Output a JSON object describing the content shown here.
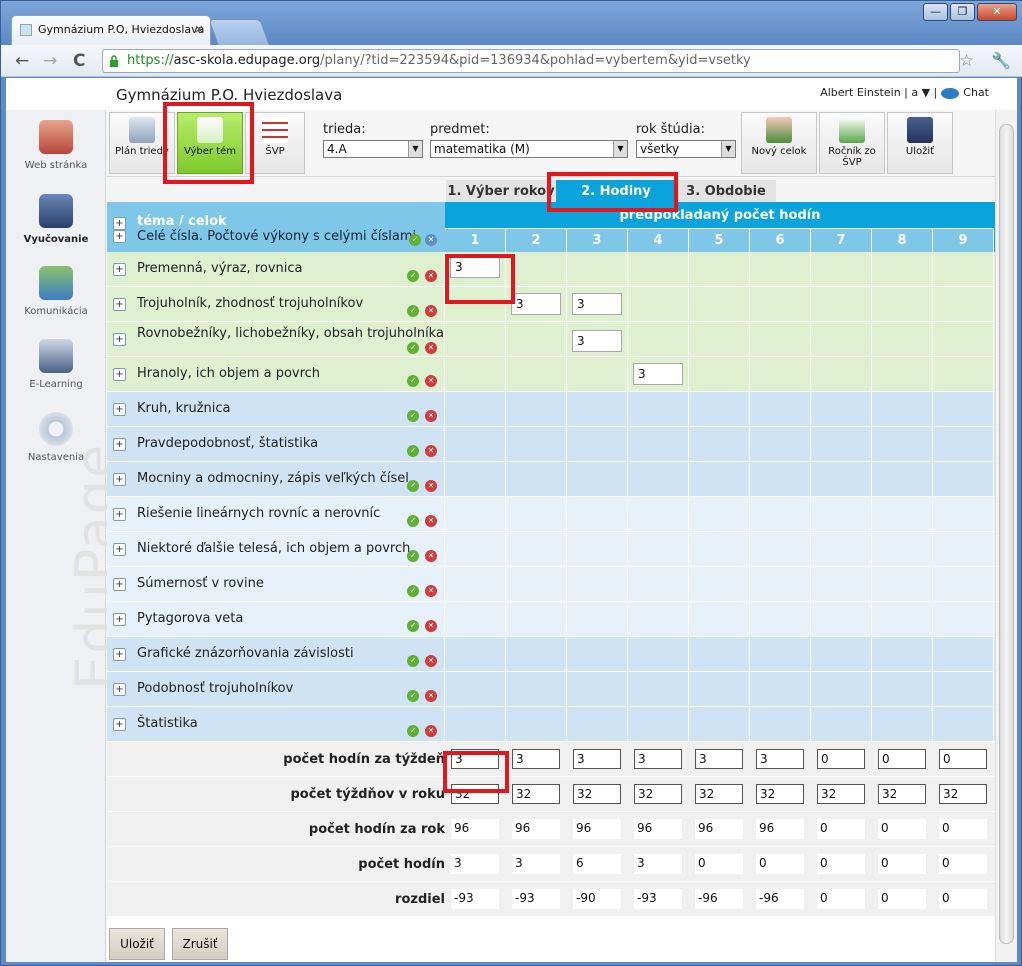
{
  "browser": {
    "tab_title": "Gymnázium P.O, Hviezdoslava",
    "tab_close": "×",
    "url_scheme": "https://",
    "url_host": "asc-skola.edupage.org",
    "url_path": "/plany/?tid=223594&pid=136934&pohlad=vybertem&yid=vsetky",
    "back": "←",
    "forward": "→",
    "reload": "C",
    "star": "☆",
    "wrench": "🔧",
    "minimize": "—",
    "maximize": "❐",
    "close": "✕"
  },
  "header": {
    "school": "Gymnázium P.O. Hviezdoslava",
    "user": "Albert Einstein | a ▼ |",
    "chat": "Chat"
  },
  "sidebar": {
    "items": [
      {
        "label": "Web stránka",
        "icon": "house-icon"
      },
      {
        "label": "Vyučovanie",
        "icon": "teaching-icon"
      },
      {
        "label": "Komunikácia",
        "icon": "people-icon"
      },
      {
        "label": "E-Learning",
        "icon": "monitor-icon"
      },
      {
        "label": "Nastavenia",
        "icon": "gear-icon"
      }
    ],
    "watermark": "EduPage"
  },
  "toolbar": {
    "plan_label": "Plán triedy",
    "select_topics_label": "Výber tém",
    "svp_label": "ŠVP",
    "trieda_label": "trieda:",
    "trieda_value": "4.A",
    "predmet_label": "predmet:",
    "predmet_value": "matematika (M)",
    "rok_label": "rok štúdia:",
    "rok_value": "všetky",
    "new_unit_label": "Nový celok",
    "year_from_svp_label": "Ročník zo ŠVP",
    "save_label": "Uložiť"
  },
  "tabs": [
    "1. Výber rokov",
    "2. Hodiny",
    "3. Obdobie"
  ],
  "grid": {
    "topic_header": "téma / celok",
    "group_label": "Celé čísla. Počtové výkony s celými číslami",
    "hours_header": "predpokladaný počet hodín",
    "columns": [
      "1",
      "2",
      "3",
      "4",
      "5",
      "6",
      "7",
      "8",
      "9"
    ],
    "topics": [
      {
        "label": "Premenná, výraz, rovnica",
        "values": [
          "3",
          "",
          "",
          "",
          "",
          "",
          "",
          "",
          ""
        ]
      },
      {
        "label": "Trojuholník, zhodnosť trojuholníkov",
        "values": [
          "",
          "3",
          "3",
          "",
          "",
          "",
          "",
          "",
          ""
        ]
      },
      {
        "label": "Rovnobežníky, lichobežníky, obsah trojuholníka",
        "values": [
          "",
          "",
          "3",
          "",
          "",
          "",
          "",
          "",
          ""
        ]
      },
      {
        "label": "Hranoly, ich objem a povrch",
        "values": [
          "",
          "",
          "",
          "3",
          "",
          "",
          "",
          "",
          ""
        ]
      },
      {
        "label": "Kruh, kružnica",
        "values": [
          "",
          "",
          "",
          "",
          "",
          "",
          "",
          "",
          ""
        ]
      },
      {
        "label": "Pravdepodobnosť, štatistika",
        "values": [
          "",
          "",
          "",
          "",
          "",
          "",
          "",
          "",
          ""
        ]
      },
      {
        "label": "Mocniny a odmocniny, zápis veľkých čísel",
        "values": [
          "",
          "",
          "",
          "",
          "",
          "",
          "",
          "",
          ""
        ]
      },
      {
        "label": "Riešenie lineárnych rovníc a nerovníc",
        "values": [
          "",
          "",
          "",
          "",
          "",
          "",
          "",
          "",
          ""
        ]
      },
      {
        "label": "Niektoré ďalšie telesá, ich objem a povrch",
        "values": [
          "",
          "",
          "",
          "",
          "",
          "",
          "",
          "",
          ""
        ]
      },
      {
        "label": "Súmernosť v rovine",
        "values": [
          "",
          "",
          "",
          "",
          "",
          "",
          "",
          "",
          ""
        ]
      },
      {
        "label": "Pytagorova veta",
        "values": [
          "",
          "",
          "",
          "",
          "",
          "",
          "",
          "",
          ""
        ]
      },
      {
        "label": "Grafické znázorňovania závislosti",
        "values": [
          "",
          "",
          "",
          "",
          "",
          "",
          "",
          "",
          ""
        ]
      },
      {
        "label": "Podobnosť trojuholníkov",
        "values": [
          "",
          "",
          "",
          "",
          "",
          "",
          "",
          "",
          ""
        ]
      },
      {
        "label": "Štatistika",
        "values": [
          "",
          "",
          "",
          "",
          "",
          "",
          "",
          "",
          ""
        ]
      }
    ],
    "summary": [
      {
        "label": "počet hodín za týždeň",
        "values": [
          "3",
          "3",
          "3",
          "3",
          "3",
          "3",
          "0",
          "0",
          "0"
        ],
        "editable": true
      },
      {
        "label": "počet týždňov v roku",
        "values": [
          "32",
          "32",
          "32",
          "32",
          "32",
          "32",
          "32",
          "32",
          "32"
        ],
        "editable": true
      },
      {
        "label": "počet hodín za rok",
        "values": [
          "96",
          "96",
          "96",
          "96",
          "96",
          "96",
          "0",
          "0",
          "0"
        ],
        "editable": false
      },
      {
        "label": "počet hodín",
        "values": [
          "3",
          "3",
          "6",
          "3",
          "0",
          "0",
          "0",
          "0",
          "0"
        ],
        "editable": false
      },
      {
        "label": "rozdiel",
        "values": [
          "-93",
          "-93",
          "-90",
          "-93",
          "-96",
          "-96",
          "0",
          "0",
          "0"
        ],
        "editable": false
      }
    ]
  },
  "actions": {
    "save": "Uložiť",
    "cancel": "Zrušiť"
  },
  "colors": {
    "accent": "#0aa3dc",
    "highlight": "#e0171f",
    "green_row": "#dff0d0",
    "blue_row": "#cfe3f4",
    "light_row": "#e6f1fa"
  }
}
